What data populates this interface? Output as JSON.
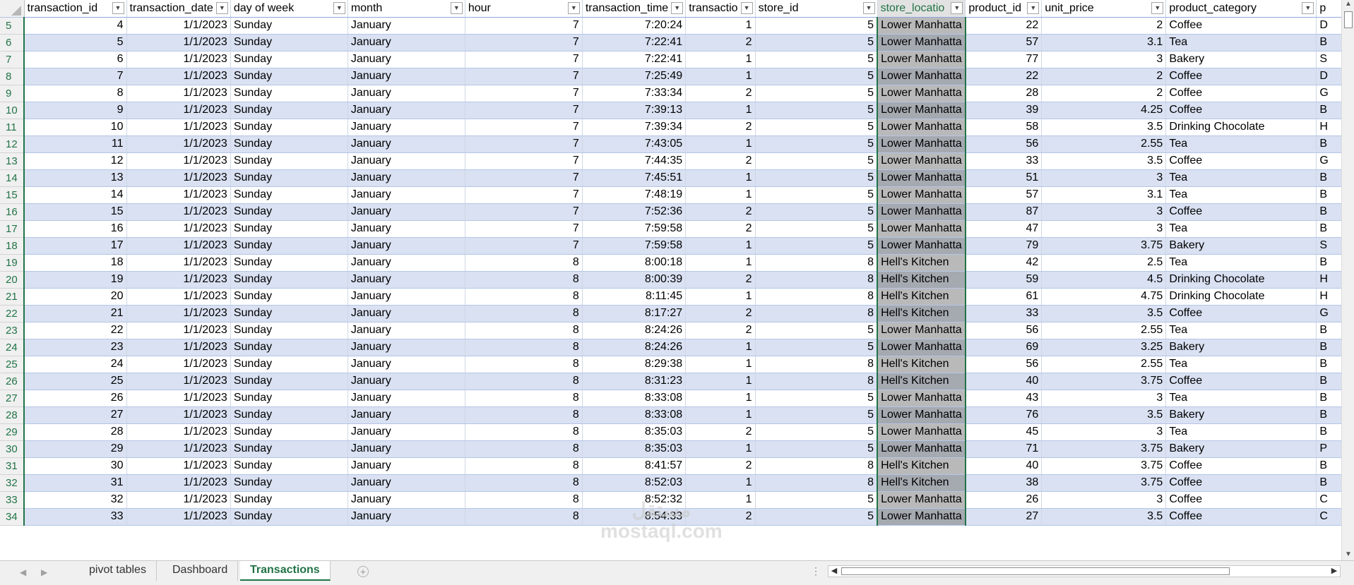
{
  "columns": [
    {
      "key": "transaction_id",
      "label": "transaction_id",
      "align": "r"
    },
    {
      "key": "transaction_date",
      "label": "transaction_date",
      "align": "r"
    },
    {
      "key": "day_of_week",
      "label": "day of week",
      "align": "l"
    },
    {
      "key": "month",
      "label": "month",
      "align": "l"
    },
    {
      "key": "hour",
      "label": "hour",
      "align": "r"
    },
    {
      "key": "transaction_time",
      "label": "transaction_time",
      "align": "r"
    },
    {
      "key": "transaction_qty",
      "label": "transactio",
      "align": "r"
    },
    {
      "key": "store_id",
      "label": "store_id",
      "align": "r"
    },
    {
      "key": "store_location",
      "label": "store_locatio",
      "align": "l",
      "selected": true
    },
    {
      "key": "product_id",
      "label": "product_id",
      "align": "r"
    },
    {
      "key": "unit_price",
      "label": "unit_price",
      "align": "r"
    },
    {
      "key": "product_category",
      "label": "product_category",
      "align": "l"
    },
    {
      "key": "product_type",
      "label": "p",
      "align": "l"
    }
  ],
  "rows": [
    {
      "rn": "5",
      "v": [
        "4",
        "1/1/2023",
        "Sunday",
        "January",
        "7",
        "7:20:24",
        "1",
        "5",
        "Lower Manhatta",
        "22",
        "2",
        "Coffee",
        "D"
      ]
    },
    {
      "rn": "6",
      "v": [
        "5",
        "1/1/2023",
        "Sunday",
        "January",
        "7",
        "7:22:41",
        "2",
        "5",
        "Lower Manhatta",
        "57",
        "3.1",
        "Tea",
        "B"
      ]
    },
    {
      "rn": "7",
      "v": [
        "6",
        "1/1/2023",
        "Sunday",
        "January",
        "7",
        "7:22:41",
        "1",
        "5",
        "Lower Manhatta",
        "77",
        "3",
        "Bakery",
        "S"
      ]
    },
    {
      "rn": "8",
      "v": [
        "7",
        "1/1/2023",
        "Sunday",
        "January",
        "7",
        "7:25:49",
        "1",
        "5",
        "Lower Manhatta",
        "22",
        "2",
        "Coffee",
        "D"
      ]
    },
    {
      "rn": "9",
      "v": [
        "8",
        "1/1/2023",
        "Sunday",
        "January",
        "7",
        "7:33:34",
        "2",
        "5",
        "Lower Manhatta",
        "28",
        "2",
        "Coffee",
        "G"
      ]
    },
    {
      "rn": "10",
      "v": [
        "9",
        "1/1/2023",
        "Sunday",
        "January",
        "7",
        "7:39:13",
        "1",
        "5",
        "Lower Manhatta",
        "39",
        "4.25",
        "Coffee",
        "B"
      ]
    },
    {
      "rn": "11",
      "v": [
        "10",
        "1/1/2023",
        "Sunday",
        "January",
        "7",
        "7:39:34",
        "2",
        "5",
        "Lower Manhatta",
        "58",
        "3.5",
        "Drinking Chocolate",
        "H"
      ]
    },
    {
      "rn": "12",
      "v": [
        "11",
        "1/1/2023",
        "Sunday",
        "January",
        "7",
        "7:43:05",
        "1",
        "5",
        "Lower Manhatta",
        "56",
        "2.55",
        "Tea",
        "B"
      ]
    },
    {
      "rn": "13",
      "v": [
        "12",
        "1/1/2023",
        "Sunday",
        "January",
        "7",
        "7:44:35",
        "2",
        "5",
        "Lower Manhatta",
        "33",
        "3.5",
        "Coffee",
        "G"
      ]
    },
    {
      "rn": "14",
      "v": [
        "13",
        "1/1/2023",
        "Sunday",
        "January",
        "7",
        "7:45:51",
        "1",
        "5",
        "Lower Manhatta",
        "51",
        "3",
        "Tea",
        "B"
      ]
    },
    {
      "rn": "15",
      "v": [
        "14",
        "1/1/2023",
        "Sunday",
        "January",
        "7",
        "7:48:19",
        "1",
        "5",
        "Lower Manhatta",
        "57",
        "3.1",
        "Tea",
        "B"
      ]
    },
    {
      "rn": "16",
      "v": [
        "15",
        "1/1/2023",
        "Sunday",
        "January",
        "7",
        "7:52:36",
        "2",
        "5",
        "Lower Manhatta",
        "87",
        "3",
        "Coffee",
        "B"
      ]
    },
    {
      "rn": "17",
      "v": [
        "16",
        "1/1/2023",
        "Sunday",
        "January",
        "7",
        "7:59:58",
        "2",
        "5",
        "Lower Manhatta",
        "47",
        "3",
        "Tea",
        "B"
      ]
    },
    {
      "rn": "18",
      "v": [
        "17",
        "1/1/2023",
        "Sunday",
        "January",
        "7",
        "7:59:58",
        "1",
        "5",
        "Lower Manhatta",
        "79",
        "3.75",
        "Bakery",
        "S"
      ]
    },
    {
      "rn": "19",
      "v": [
        "18",
        "1/1/2023",
        "Sunday",
        "January",
        "8",
        "8:00:18",
        "1",
        "8",
        "Hell's Kitchen",
        "42",
        "2.5",
        "Tea",
        "B"
      ]
    },
    {
      "rn": "20",
      "v": [
        "19",
        "1/1/2023",
        "Sunday",
        "January",
        "8",
        "8:00:39",
        "2",
        "8",
        "Hell's Kitchen",
        "59",
        "4.5",
        "Drinking Chocolate",
        "H"
      ]
    },
    {
      "rn": "21",
      "v": [
        "20",
        "1/1/2023",
        "Sunday",
        "January",
        "8",
        "8:11:45",
        "1",
        "8",
        "Hell's Kitchen",
        "61",
        "4.75",
        "Drinking Chocolate",
        "H"
      ]
    },
    {
      "rn": "22",
      "v": [
        "21",
        "1/1/2023",
        "Sunday",
        "January",
        "8",
        "8:17:27",
        "2",
        "8",
        "Hell's Kitchen",
        "33",
        "3.5",
        "Coffee",
        "G"
      ]
    },
    {
      "rn": "23",
      "v": [
        "22",
        "1/1/2023",
        "Sunday",
        "January",
        "8",
        "8:24:26",
        "2",
        "5",
        "Lower Manhatta",
        "56",
        "2.55",
        "Tea",
        "B"
      ]
    },
    {
      "rn": "24",
      "v": [
        "23",
        "1/1/2023",
        "Sunday",
        "January",
        "8",
        "8:24:26",
        "1",
        "5",
        "Lower Manhatta",
        "69",
        "3.25",
        "Bakery",
        "B"
      ]
    },
    {
      "rn": "25",
      "v": [
        "24",
        "1/1/2023",
        "Sunday",
        "January",
        "8",
        "8:29:38",
        "1",
        "8",
        "Hell's Kitchen",
        "56",
        "2.55",
        "Tea",
        "B"
      ]
    },
    {
      "rn": "26",
      "v": [
        "25",
        "1/1/2023",
        "Sunday",
        "January",
        "8",
        "8:31:23",
        "1",
        "8",
        "Hell's Kitchen",
        "40",
        "3.75",
        "Coffee",
        "B"
      ]
    },
    {
      "rn": "27",
      "v": [
        "26",
        "1/1/2023",
        "Sunday",
        "January",
        "8",
        "8:33:08",
        "1",
        "5",
        "Lower Manhatta",
        "43",
        "3",
        "Tea",
        "B"
      ]
    },
    {
      "rn": "28",
      "v": [
        "27",
        "1/1/2023",
        "Sunday",
        "January",
        "8",
        "8:33:08",
        "1",
        "5",
        "Lower Manhatta",
        "76",
        "3.5",
        "Bakery",
        "B"
      ]
    },
    {
      "rn": "29",
      "v": [
        "28",
        "1/1/2023",
        "Sunday",
        "January",
        "8",
        "8:35:03",
        "2",
        "5",
        "Lower Manhatta",
        "45",
        "3",
        "Tea",
        "B"
      ]
    },
    {
      "rn": "30",
      "v": [
        "29",
        "1/1/2023",
        "Sunday",
        "January",
        "8",
        "8:35:03",
        "1",
        "5",
        "Lower Manhatta",
        "71",
        "3.75",
        "Bakery",
        "P"
      ]
    },
    {
      "rn": "31",
      "v": [
        "30",
        "1/1/2023",
        "Sunday",
        "January",
        "8",
        "8:41:57",
        "2",
        "8",
        "Hell's Kitchen",
        "40",
        "3.75",
        "Coffee",
        "B"
      ]
    },
    {
      "rn": "32",
      "v": [
        "31",
        "1/1/2023",
        "Sunday",
        "January",
        "8",
        "8:52:03",
        "1",
        "8",
        "Hell's Kitchen",
        "38",
        "3.75",
        "Coffee",
        "B"
      ]
    },
    {
      "rn": "33",
      "v": [
        "32",
        "1/1/2023",
        "Sunday",
        "January",
        "8",
        "8:52:32",
        "1",
        "5",
        "Lower Manhatta",
        "26",
        "3",
        "Coffee",
        "C"
      ]
    },
    {
      "rn": "34",
      "v": [
        "33",
        "1/1/2023",
        "Sunday",
        "January",
        "8",
        "8:54:33",
        "2",
        "5",
        "Lower Manhatta",
        "27",
        "3.5",
        "Coffee",
        "C"
      ]
    }
  ],
  "sheet_tabs": [
    {
      "label": "pivot tables",
      "active": false
    },
    {
      "label": "Dashboard",
      "active": false
    },
    {
      "label": "Transactions",
      "active": true
    }
  ],
  "watermark": {
    "line1": "مستقل",
    "line2": "mostaql.com"
  },
  "colors": {
    "accent": "#217346",
    "band": "#d9e1f2",
    "selected_col": "#b9b9b9"
  }
}
